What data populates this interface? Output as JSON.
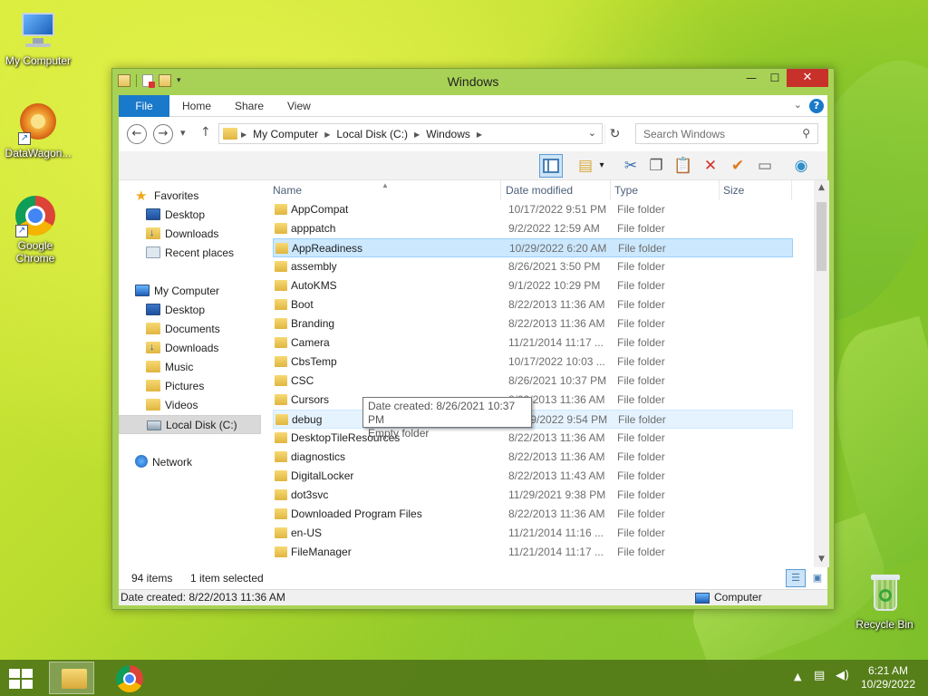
{
  "desktop": {
    "icons": [
      {
        "label": "My Computer"
      },
      {
        "label": "DataWagon..."
      },
      {
        "label": "Google Chrome"
      },
      {
        "label": "Recycle Bin"
      }
    ]
  },
  "window": {
    "title": "Windows",
    "controls": {
      "minimize": "—",
      "maximize": "☐",
      "close": "✕"
    }
  },
  "ribbon": {
    "tabs": [
      "File",
      "Home",
      "Share",
      "View"
    ],
    "help": "?"
  },
  "navigation": {
    "back": "←",
    "forward": "→",
    "recent": "▾",
    "up": "↑",
    "breadcrumbs": [
      "My Computer",
      "Local Disk (C:)",
      "Windows"
    ],
    "search_placeholder": "Search Windows"
  },
  "nav_pane": {
    "favorites_label": "Favorites",
    "favorites": [
      "Desktop",
      "Downloads",
      "Recent places"
    ],
    "computer_label": "My Computer",
    "computer_items": [
      "Desktop",
      "Documents",
      "Downloads",
      "Music",
      "Pictures",
      "Videos",
      "Local Disk (C:)"
    ],
    "network_label": "Network"
  },
  "columns": {
    "name": "Name",
    "date": "Date modified",
    "type": "Type",
    "size": "Size"
  },
  "files": [
    {
      "name": "AppCompat",
      "date": "10/17/2022 9:51 PM",
      "type": "File folder"
    },
    {
      "name": "apppatch",
      "date": "9/2/2022 12:59 AM",
      "type": "File folder"
    },
    {
      "name": "AppReadiness",
      "date": "10/29/2022 6:20 AM",
      "type": "File folder"
    },
    {
      "name": "assembly",
      "date": "8/26/2021 3:50 PM",
      "type": "File folder"
    },
    {
      "name": "AutoKMS",
      "date": "9/1/2022 10:29 PM",
      "type": "File folder"
    },
    {
      "name": "Boot",
      "date": "8/22/2013 11:36 AM",
      "type": "File folder"
    },
    {
      "name": "Branding",
      "date": "8/22/2013 11:36 AM",
      "type": "File folder"
    },
    {
      "name": "Camera",
      "date": "11/21/2014 11:17 ...",
      "type": "File folder"
    },
    {
      "name": "CbsTemp",
      "date": "10/17/2022 10:03 ...",
      "type": "File folder"
    },
    {
      "name": "CSC",
      "date": "8/26/2021 10:37 PM",
      "type": "File folder"
    },
    {
      "name": "Cursors",
      "date": "8/22/2013 11:36 AM",
      "type": "File folder"
    },
    {
      "name": "debug",
      "date": "10/29/2022 9:54 PM",
      "type": "File folder"
    },
    {
      "name": "DesktopTileResources",
      "date": "8/22/2013 11:36 AM",
      "type": "File folder"
    },
    {
      "name": "diagnostics",
      "date": "8/22/2013 11:36 AM",
      "type": "File folder"
    },
    {
      "name": "DigitalLocker",
      "date": "8/22/2013 11:43 AM",
      "type": "File folder"
    },
    {
      "name": "dot3svc",
      "date": "11/29/2021 9:38 PM",
      "type": "File folder"
    },
    {
      "name": "Downloaded Program Files",
      "date": "8/22/2013 11:36 AM",
      "type": "File folder"
    },
    {
      "name": "en-US",
      "date": "11/21/2014 11:16 ...",
      "type": "File folder"
    },
    {
      "name": "FileManager",
      "date": "11/21/2014 11:17 ...",
      "type": "File folder"
    }
  ],
  "tooltip": {
    "line1": "Date created: 8/26/2021 10:37 PM",
    "line2": "Empty folder"
  },
  "status": {
    "item_count": "94 items",
    "selection": "1 item selected",
    "details": "Date created: 8/22/2013 11:36 AM",
    "location": "Computer"
  },
  "taskbar": {
    "time": "6:21 AM",
    "date": "10/29/2022",
    "tray_chevron": "▲"
  },
  "colors": {
    "accent": "#1979ca",
    "selection": "#cce8ff",
    "window_frame": "#a8d256",
    "close": "#c7312a"
  }
}
